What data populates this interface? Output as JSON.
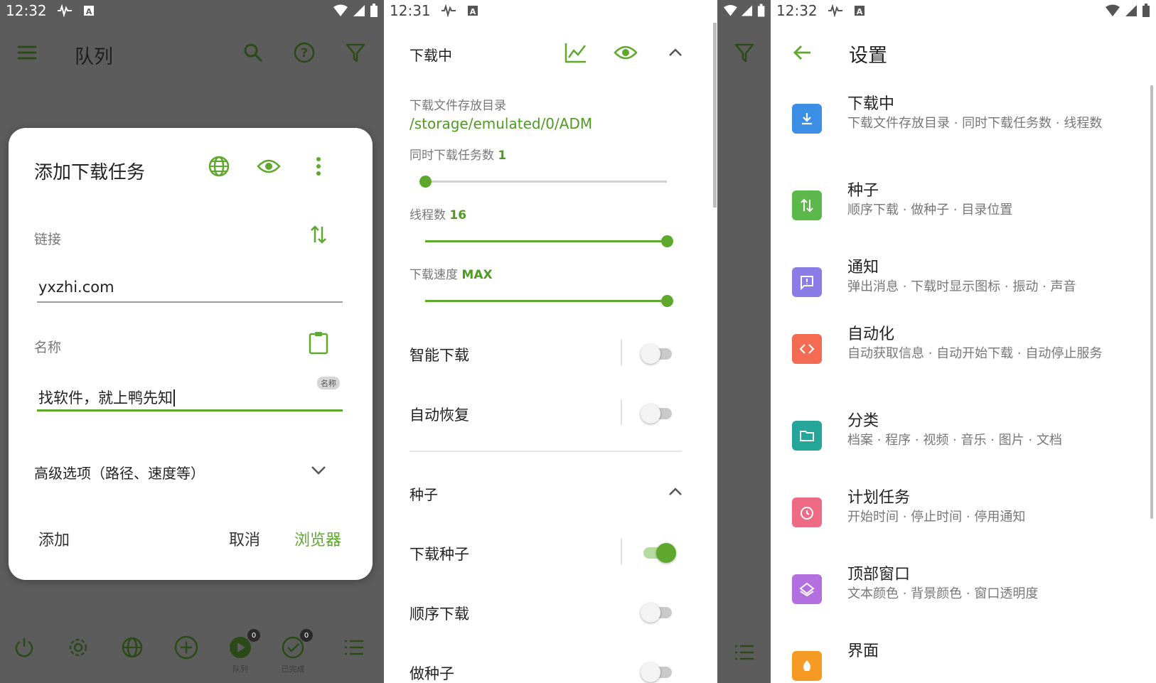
{
  "colors": {
    "accent": "#5fa82e",
    "overlay": "#5c5c5c"
  },
  "panel1": {
    "status_time": "12:32",
    "toolbar_title": "队列",
    "dialog": {
      "title": "添加下载任务",
      "link_label": "链接",
      "link_value": "yxzhi.com",
      "name_label": "名称",
      "name_chip": "名称",
      "name_value": "找软件，就上鸭先知",
      "advanced": "高级选项（路径、速度等）",
      "add": "添加",
      "cancel": "取消",
      "browser": "浏览器"
    },
    "bottom": {
      "queue_label": "队列",
      "queue_badge": "0",
      "done_label": "已完成",
      "done_badge": "0"
    }
  },
  "panel2": {
    "status_time": "12:31",
    "section_download": "下载中",
    "dir_label": "下载文件存放目录",
    "dir_path": "/storage/emulated/0/ADM",
    "tasks_label": "同时下载任务数",
    "tasks_value": "1",
    "tasks_level": 0,
    "threads_label": "线程数",
    "threads_value": "16",
    "threads_level": 1,
    "speed_label": "下载速度",
    "speed_value": "MAX",
    "speed_level": 1,
    "smart_download": "智能下载",
    "smart_download_on": false,
    "auto_resume": "自动恢复",
    "auto_resume_on": false,
    "section_torrent": "种子",
    "download_torrent": "下载种子",
    "download_torrent_on": true,
    "sequential": "顺序下载",
    "sequential_on": false,
    "make_torrent": "做种子",
    "make_torrent_on": false
  },
  "panel3": {
    "status_time": "12:32",
    "title": "设置",
    "items": [
      {
        "title": "下载中",
        "sub": "下载文件存放目录 · 同时下载任务数 · 线程数",
        "color": "#3d8fe6",
        "icon": "download-icon"
      },
      {
        "title": "种子",
        "sub": "顺序下载 · 做种子 · 目录位置",
        "color": "#5cb84a",
        "icon": "swap-vert-icon"
      },
      {
        "title": "通知",
        "sub": "弹出消息 · 下载时显示图标 · 振动 · 声音",
        "color": "#8c7ce8",
        "icon": "message-icon"
      },
      {
        "title": "自动化",
        "sub": "自动获取信息 · 自动开始下载 · 自动停止服务",
        "color": "#f26b52",
        "icon": "code-icon"
      },
      {
        "title": "分类",
        "sub": "档案 · 程序 · 视频 · 音乐 · 图片 · 文档",
        "color": "#26a69a",
        "icon": "folder-icon"
      },
      {
        "title": "计划任务",
        "sub": "开始时间 · 停止时间 · 停用通知",
        "color": "#ee6a85",
        "icon": "alarm-icon"
      },
      {
        "title": "顶部窗口",
        "sub": "文本颜色 · 背景颜色 · 窗口透明度",
        "color": "#b36fe0",
        "icon": "layers-icon"
      },
      {
        "title": "界面",
        "sub": "",
        "color": "#f59a23",
        "icon": "palette-icon"
      }
    ]
  }
}
